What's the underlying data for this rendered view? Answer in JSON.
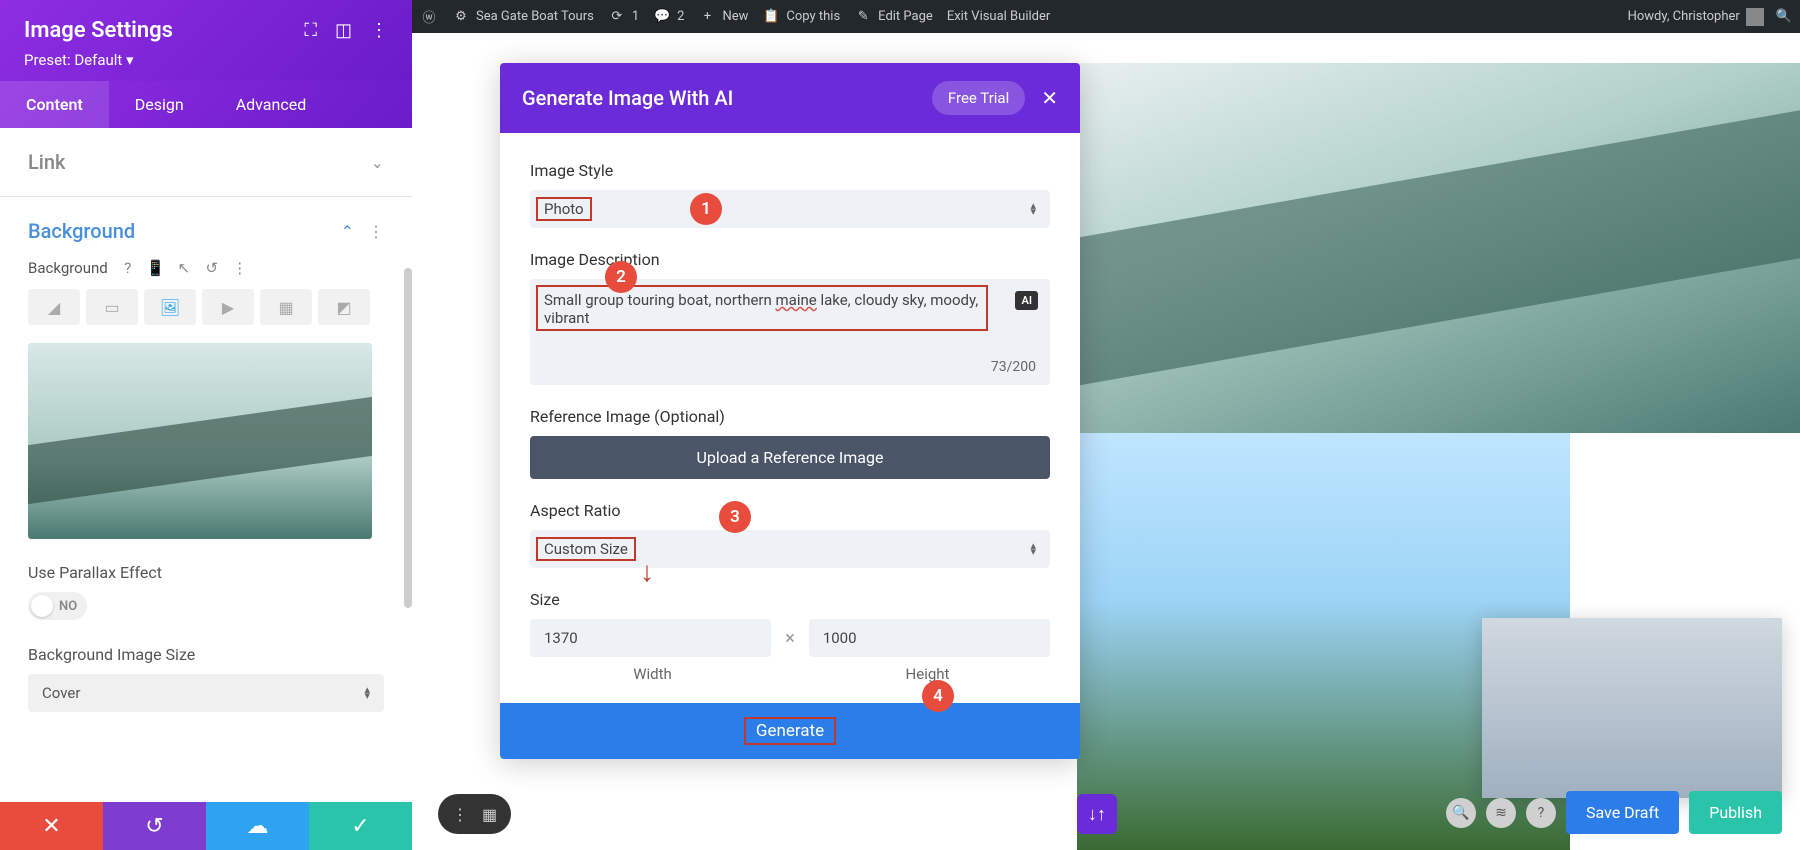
{
  "admin_bar": {
    "site_name": "Sea Gate Boat Tours",
    "updates_count": "1",
    "comments_count": "2",
    "new_label": "New",
    "copy_label": "Copy this",
    "edit_label": "Edit Page",
    "exit_label": "Exit Visual Builder",
    "howdy": "Howdy, Christopher"
  },
  "sidebar": {
    "title": "Image Settings",
    "preset": "Preset: Default ▾",
    "tabs": {
      "content": "Content",
      "design": "Design",
      "advanced": "Advanced"
    },
    "link_panel": "Link",
    "background_panel": "Background",
    "bg_label": "Background",
    "parallax_label": "Use Parallax Effect",
    "parallax_value": "NO",
    "bg_size_label": "Background Image Size",
    "bg_size_value": "Cover"
  },
  "ai_modal": {
    "title": "Generate Image With AI",
    "free_trial": "Free Trial",
    "style_label": "Image Style",
    "style_value": "Photo",
    "desc_label": "Image Description",
    "desc_value_pre": "Small group touring boat, northern ",
    "desc_value_spell": "maine",
    "desc_value_post": " lake, cloudy sky, moody, vibrant",
    "ai_tag": "AI",
    "char_count": "73/200",
    "ref_label": "Reference Image (Optional)",
    "upload_label": "Upload a Reference Image",
    "aspect_label": "Aspect Ratio",
    "aspect_value": "Custom Size",
    "size_label": "Size",
    "width_value": "1370",
    "height_value": "1000",
    "width_label": "Width",
    "height_label": "Height",
    "generate_label": "Generate"
  },
  "badges": {
    "b1": "1",
    "b2": "2",
    "b3": "3",
    "b4": "4"
  },
  "bottom": {
    "save_draft": "Save Draft",
    "publish": "Publish",
    "help": "?"
  }
}
